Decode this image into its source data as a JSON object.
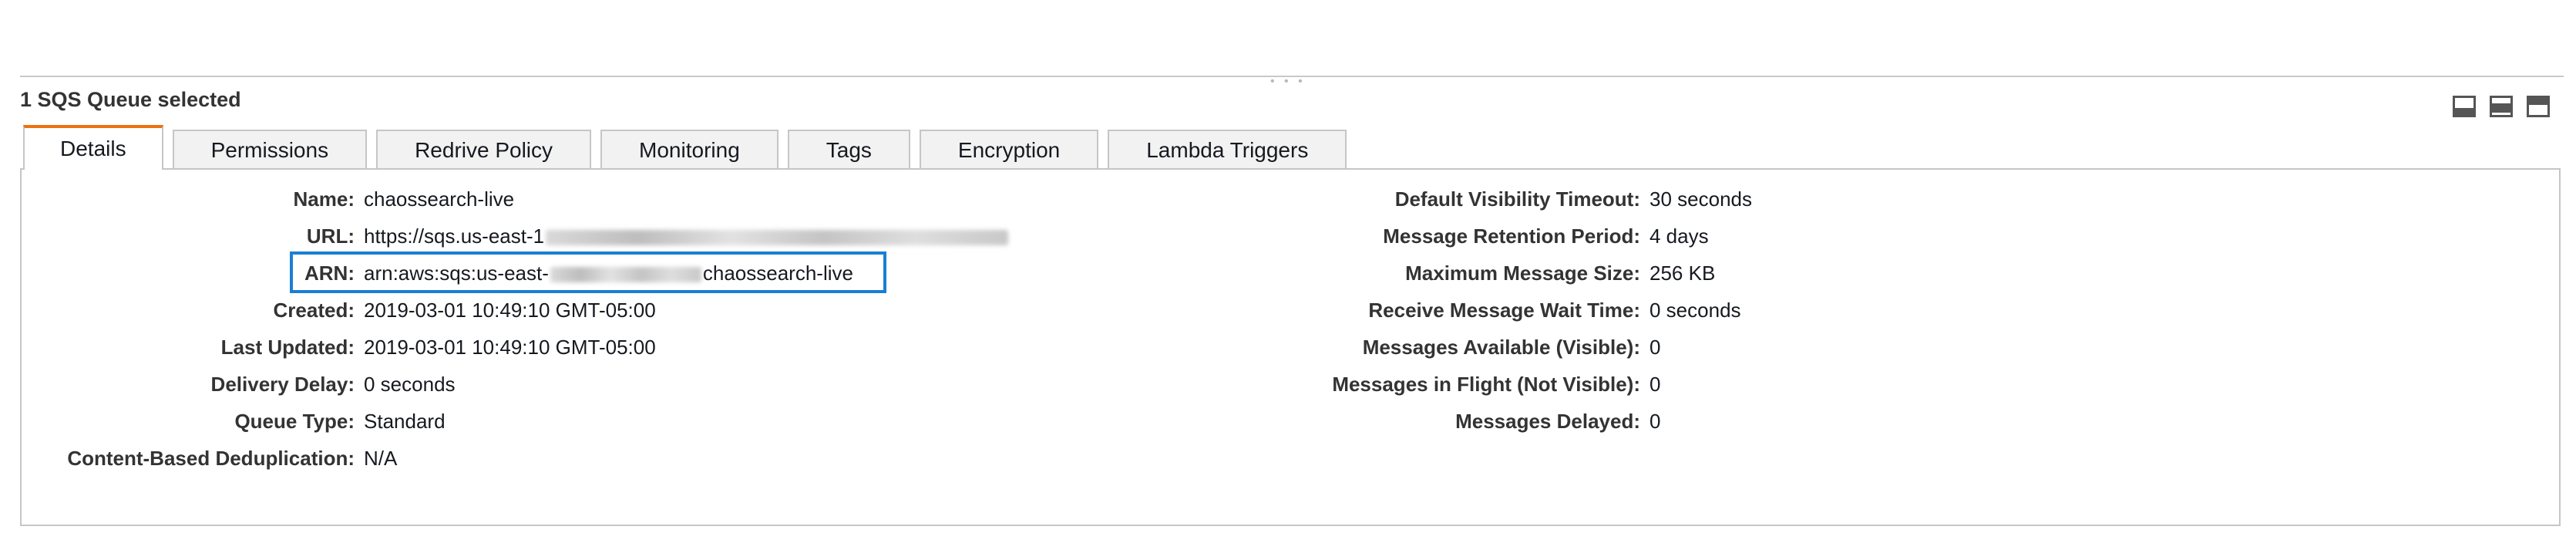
{
  "panel": {
    "title": "1 SQS Queue selected",
    "drag_handle": "• • •"
  },
  "tabs": [
    {
      "label": "Details",
      "active": true
    },
    {
      "label": "Permissions",
      "active": false
    },
    {
      "label": "Redrive Policy",
      "active": false
    },
    {
      "label": "Monitoring",
      "active": false
    },
    {
      "label": "Tags",
      "active": false
    },
    {
      "label": "Encryption",
      "active": false
    },
    {
      "label": "Lambda Triggers",
      "active": false
    }
  ],
  "details_left": {
    "name": {
      "label": "Name:",
      "value": "chaossearch-live"
    },
    "url": {
      "label": "URL:",
      "value_prefix": "https://sqs.us-east-1"
    },
    "arn": {
      "label": "ARN:",
      "value_prefix": "arn:aws:sqs:us-east-",
      "value_suffix": "chaossearch-live"
    },
    "created": {
      "label": "Created:",
      "value": "2019-03-01 10:49:10 GMT-05:00"
    },
    "last_updated": {
      "label": "Last Updated:",
      "value": "2019-03-01 10:49:10 GMT-05:00"
    },
    "delivery_delay": {
      "label": "Delivery Delay:",
      "value": "0 seconds"
    },
    "queue_type": {
      "label": "Queue Type:",
      "value": "Standard"
    },
    "content_dedup": {
      "label": "Content-Based Deduplication:",
      "value": "N/A"
    }
  },
  "details_right": {
    "visibility_timeout": {
      "label": "Default Visibility Timeout:",
      "value": "30 seconds"
    },
    "retention_period": {
      "label": "Message Retention Period:",
      "value": "4 days"
    },
    "max_message_size": {
      "label": "Maximum Message Size:",
      "value": "256 KB"
    },
    "receive_wait_time": {
      "label": "Receive Message Wait Time:",
      "value": "0 seconds"
    },
    "messages_available": {
      "label": "Messages Available (Visible):",
      "value": "0"
    },
    "messages_in_flight": {
      "label": "Messages in Flight (Not Visible):",
      "value": "0"
    },
    "messages_delayed": {
      "label": "Messages Delayed:",
      "value": "0"
    }
  },
  "colors": {
    "active_tab_accent": "#ec7211",
    "arn_highlight": "#1a7fd4"
  }
}
